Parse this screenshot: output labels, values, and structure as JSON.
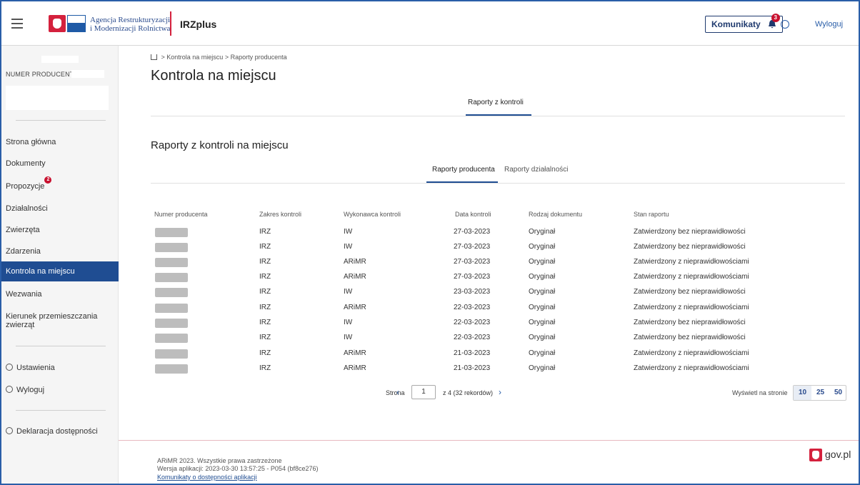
{
  "header": {
    "agency_line1": "Agencja Restrukturyzacji",
    "agency_line2": "i Modernizacji Rolnictwa",
    "app_name": "IRZplus",
    "komunikaty_label": "Komunikaty",
    "komunikaty_count": "3",
    "logout_label": "Wyloguj"
  },
  "sidebar": {
    "producer_label": "NUMER PRODUCENTA:",
    "nav": [
      {
        "label": "Strona główna"
      },
      {
        "label": "Dokumenty"
      },
      {
        "label": "Propozycje",
        "badge": "2"
      },
      {
        "label": "Działalności"
      },
      {
        "label": "Zwierzęta"
      },
      {
        "label": "Zdarzenia"
      },
      {
        "label": "Kontrola na miejscu"
      },
      {
        "label": "Wezwania"
      },
      {
        "label": "Kierunek przemieszczania zwierząt"
      }
    ],
    "settings_label": "Ustawienia",
    "logout_label": "Wyloguj",
    "accessibility_label": "Deklaracja dostępności"
  },
  "breadcrumb": [
    "Kontrola na miejscu",
    "Raporty producenta"
  ],
  "page_title": "Kontrola na miejscu",
  "top_tab": "Raporty z kontroli",
  "section_title": "Raporty z kontroli na miejscu",
  "sub_tabs": [
    "Raporty producenta",
    "Raporty działalności"
  ],
  "table": {
    "headers": [
      "Numer producenta",
      "Zakres kontroli",
      "Wykonawca kontroli",
      "Data kontroli",
      "Rodzaj dokumentu",
      "Stan raportu"
    ],
    "rows": [
      [
        "IRZ",
        "IW",
        "27-03-2023",
        "Oryginał",
        "Zatwierdzony bez nieprawidłowości"
      ],
      [
        "IRZ",
        "IW",
        "27-03-2023",
        "Oryginał",
        "Zatwierdzony bez nieprawidłowości"
      ],
      [
        "IRZ",
        "ARiMR",
        "27-03-2023",
        "Oryginał",
        "Zatwierdzony z nieprawidłowościami"
      ],
      [
        "IRZ",
        "ARiMR",
        "27-03-2023",
        "Oryginał",
        "Zatwierdzony z nieprawidłowościami"
      ],
      [
        "IRZ",
        "IW",
        "23-03-2023",
        "Oryginał",
        "Zatwierdzony bez nieprawidłowości"
      ],
      [
        "IRZ",
        "ARiMR",
        "22-03-2023",
        "Oryginał",
        "Zatwierdzony z nieprawidłowościami"
      ],
      [
        "IRZ",
        "IW",
        "22-03-2023",
        "Oryginał",
        "Zatwierdzony bez nieprawidłowości"
      ],
      [
        "IRZ",
        "IW",
        "22-03-2023",
        "Oryginał",
        "Zatwierdzony bez nieprawidłowości"
      ],
      [
        "IRZ",
        "ARiMR",
        "21-03-2023",
        "Oryginał",
        "Zatwierdzony z nieprawidłowościami"
      ],
      [
        "IRZ",
        "ARiMR",
        "21-03-2023",
        "Oryginał",
        "Zatwierdzony z nieprawidłowościami"
      ]
    ]
  },
  "pagination": {
    "page_label": "Strona",
    "current_page": "1",
    "of_label": "z 4 (32 rekordów)",
    "per_page_label": "Wyświetl na stronie",
    "per_page_options": [
      "10",
      "25",
      "50"
    ],
    "per_page_selected": "10"
  },
  "footer": {
    "copyright": "ARiMR 2023. Wszystkie prawa zastrzeżone",
    "version": "Wersja aplikacji: 2023-03-30 13:57:25 - P054 (bf8ce276)",
    "accessibility_link": "Komunikaty o dostępności aplikacji",
    "gov_label": "gov.pl"
  },
  "colors": {
    "accent": "#1f4d92",
    "brand_red": "#d4213d",
    "badge_red": "#c8102e"
  }
}
